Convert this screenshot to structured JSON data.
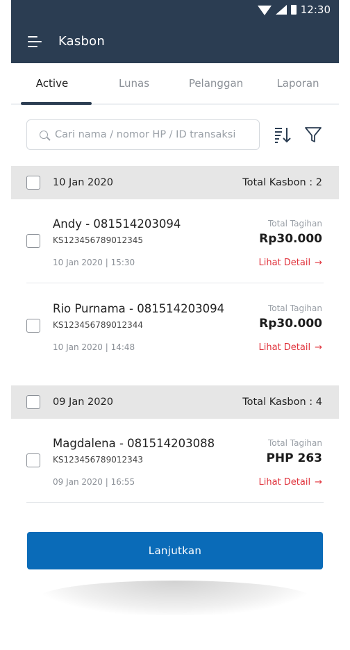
{
  "status_bar": {
    "time": "12:30",
    "icons": [
      "wifi-icon",
      "signal-icon",
      "battery-icon"
    ]
  },
  "app_bar": {
    "title": "Kasbon",
    "menu_icon": "menu-icon"
  },
  "tabs": [
    {
      "label": "Active",
      "active": true
    },
    {
      "label": "Lunas",
      "active": false
    },
    {
      "label": "Pelanggan",
      "active": false
    },
    {
      "label": "Laporan",
      "active": false
    }
  ],
  "search": {
    "placeholder": "Cari nama / nomor HP / ID transaksi",
    "value": "",
    "icon": "search-icon"
  },
  "toolbar": {
    "sort_icon": "sort-icon",
    "filter_icon": "filter-icon"
  },
  "groups": [
    {
      "date": "10 Jan 2020",
      "total": "Total Kasbon : 2",
      "items": [
        {
          "name": "Andy - 081514203094",
          "id": "KS123456789012345",
          "datetime": "10 Jan 2020 | 15:30",
          "total_label": "Total Tagihan",
          "amount": "Rp30.000",
          "detail_label": "Lihat Detail"
        },
        {
          "name": "Rio Purnama - 081514203094",
          "id": "KS123456789012344",
          "datetime": "10 Jan 2020 | 14:48",
          "total_label": "Total Tagihan",
          "amount": "Rp30.000",
          "detail_label": "Lihat Detail"
        }
      ]
    },
    {
      "date": "09 Jan 2020",
      "total": "Total Kasbon : 4",
      "items": [
        {
          "name": "Magdalena - 081514203088",
          "id": "KS123456789012343",
          "datetime": "09 Jan 2020 | 16:55",
          "total_label": "Total Tagihan",
          "amount": "PHP 263",
          "detail_label": "Lihat Detail"
        }
      ]
    }
  ],
  "cta": {
    "label": "Lanjutkan"
  },
  "colors": {
    "primary_dark": "#2b3d52",
    "accent_blue": "#0a6bb8",
    "detail_red": "#e0313a",
    "group_bg": "#e6e6e6"
  }
}
